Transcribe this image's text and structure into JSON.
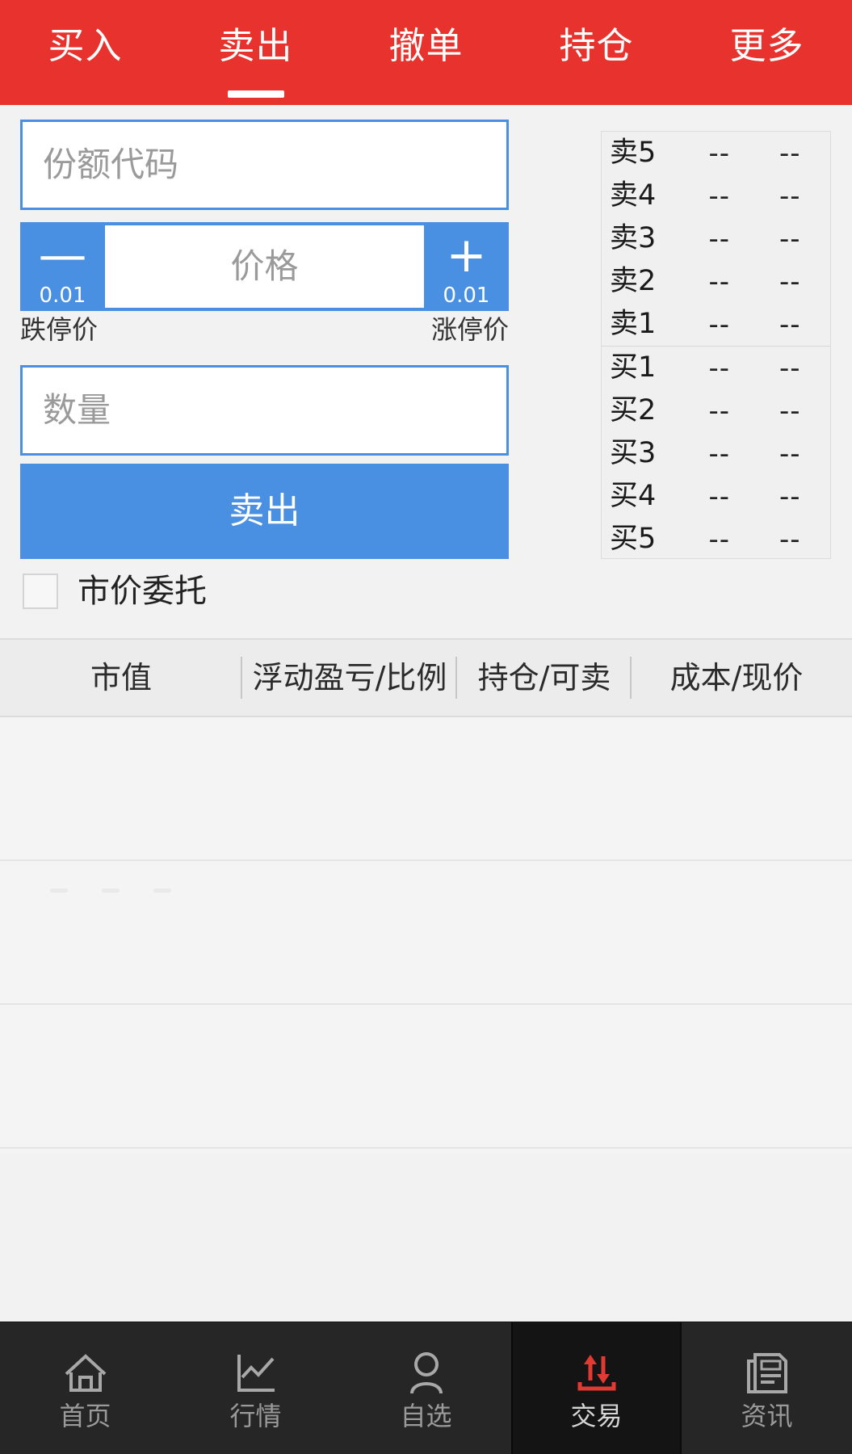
{
  "colors": {
    "top_bar": "#e8322e",
    "accent_blue": "#4a90e2",
    "nav_bg": "#262626",
    "nav_active_bg": "#141414",
    "trade_icon_red": "#e03a32",
    "placeholder_gray": "#9a9a9a"
  },
  "top_tabs": [
    {
      "label": "买入",
      "active": false
    },
    {
      "label": "卖出",
      "active": true
    },
    {
      "label": "撤单",
      "active": false
    },
    {
      "label": "持仓",
      "active": false
    },
    {
      "label": "更多",
      "active": false
    }
  ],
  "form": {
    "code_input": {
      "value": "",
      "placeholder": "份额代码"
    },
    "price_stepper": {
      "decrement_glyph": "—",
      "decrement_amount": "0.01",
      "increment_glyph": "+",
      "increment_amount": "0.01",
      "price_input": {
        "value": "",
        "placeholder": "价格"
      }
    },
    "limit_down_label": "跌停价",
    "limit_up_label": "涨停价",
    "quantity_input": {
      "value": "",
      "placeholder": "数量"
    },
    "submit_button": "卖出",
    "market_order_checkbox": {
      "label": "市价委托",
      "checked": false
    }
  },
  "orderbook": {
    "asks": [
      {
        "label": "卖5",
        "price": "--",
        "volume": "--"
      },
      {
        "label": "卖4",
        "price": "--",
        "volume": "--"
      },
      {
        "label": "卖3",
        "price": "--",
        "volume": "--"
      },
      {
        "label": "卖2",
        "price": "--",
        "volume": "--"
      },
      {
        "label": "卖1",
        "price": "--",
        "volume": "--"
      }
    ],
    "bids": [
      {
        "label": "买1",
        "price": "--",
        "volume": "--"
      },
      {
        "label": "买2",
        "price": "--",
        "volume": "--"
      },
      {
        "label": "买3",
        "price": "--",
        "volume": "--"
      },
      {
        "label": "买4",
        "price": "--",
        "volume": "--"
      },
      {
        "label": "买5",
        "price": "--",
        "volume": "--"
      }
    ]
  },
  "positions_table": {
    "columns": [
      "市值",
      "浮动盈亏/比例",
      "持仓/可卖",
      "成本/现价"
    ],
    "rows": []
  },
  "bottom_nav": [
    {
      "label": "首页",
      "icon": "home-icon",
      "active": false
    },
    {
      "label": "行情",
      "icon": "chart-icon",
      "active": false
    },
    {
      "label": "自选",
      "icon": "person-icon",
      "active": false
    },
    {
      "label": "交易",
      "icon": "trade-arrows-icon",
      "active": true
    },
    {
      "label": "资讯",
      "icon": "news-icon",
      "active": false
    }
  ]
}
